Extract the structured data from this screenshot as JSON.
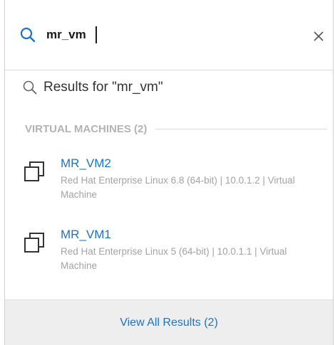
{
  "search": {
    "value": "mr_vm",
    "icon": "search-icon",
    "clear_icon": "close-icon"
  },
  "results_for": {
    "label": "Results for \"mr_vm\"",
    "icon": "search-icon"
  },
  "section": {
    "label": "VIRTUAL MACHINES (2)"
  },
  "results": [
    {
      "title": "MR_VM2",
      "meta": "Red Hat Enterprise Linux 6.8 (64-bit) | 10.0.1.2 | Virtual Machine",
      "icon": "virtual-machine-icon"
    },
    {
      "title": "MR_VM1",
      "meta": "Red Hat Enterprise Linux 5 (64-bit) | 10.0.1.1 | Virtual Machine",
      "icon": "virtual-machine-icon"
    }
  ],
  "footer": {
    "label": "View All Results (2)"
  },
  "colors": {
    "accent": "#4a90d9",
    "link": "#1e73be",
    "muted": "#a3a3a3",
    "footer_bg": "#eeeeee"
  }
}
